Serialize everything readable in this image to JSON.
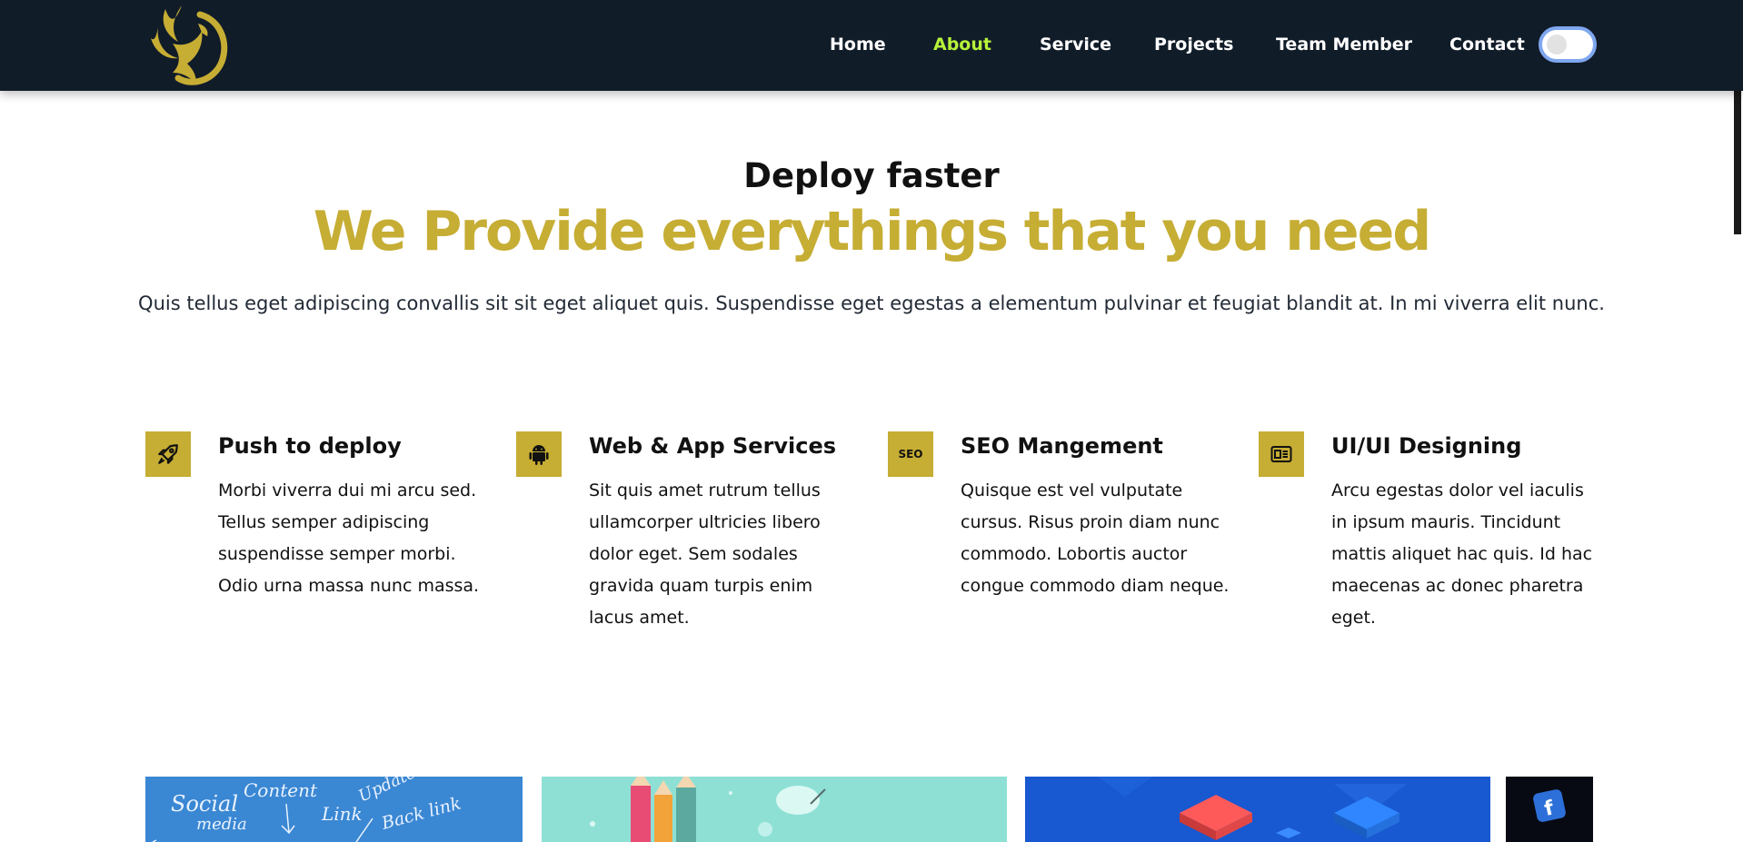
{
  "nav": {
    "items": [
      {
        "label": "Home",
        "active": false
      },
      {
        "label": "About",
        "active": true
      },
      {
        "label": "Service",
        "active": false
      },
      {
        "label": "Projects",
        "active": false
      },
      {
        "label": "Team Member",
        "active": false
      },
      {
        "label": "Contact",
        "active": false
      }
    ],
    "theme_toggle": "off",
    "logo_icon": "phoenix-logo-icon"
  },
  "hero": {
    "subtitle": "Deploy faster",
    "headline": "We Provide everythings that you need",
    "intro": "Quis tellus eget adipiscing convallis sit sit eget aliquet quis. Suspendisse eget egestas a elementum pulvinar et feugiat blandit at. In mi viverra elit nunc."
  },
  "features": [
    {
      "icon": "rocket-icon",
      "title": "Push to deploy",
      "text": "Morbi viverra dui mi arcu sed. Tellus semper adipiscing suspendisse semper morbi. Odio urna massa nunc massa."
    },
    {
      "icon": "android-icon",
      "title": "Web & App Services",
      "text": "Sit quis amet rutrum tellus ullamcorper ultricies libero dolor eget. Sem sodales gravida quam turpis enim lacus amet."
    },
    {
      "icon": "seo-icon",
      "icon_label": "SEO",
      "title": "SEO Mangement",
      "text": "Quisque est vel vulputate cursus. Risus proin diam nunc commodo. Lobortis auctor congue commodo diam neque."
    },
    {
      "icon": "layout-icon",
      "title": "UI/UI Designing",
      "text": "Arcu egestas dolor vel iaculis in ipsum mauris. Tincidunt mattis aliquet hac quis. Id hac maecenas ac donec pharetra eget."
    }
  ],
  "gallery": {
    "board_words": [
      "Social",
      "media",
      "Content",
      "Link",
      "Update",
      "Back link"
    ]
  },
  "colors": {
    "nav_bg": "#111c29",
    "accent_gold": "#c6ad34",
    "active_link": "#b6f23a"
  }
}
